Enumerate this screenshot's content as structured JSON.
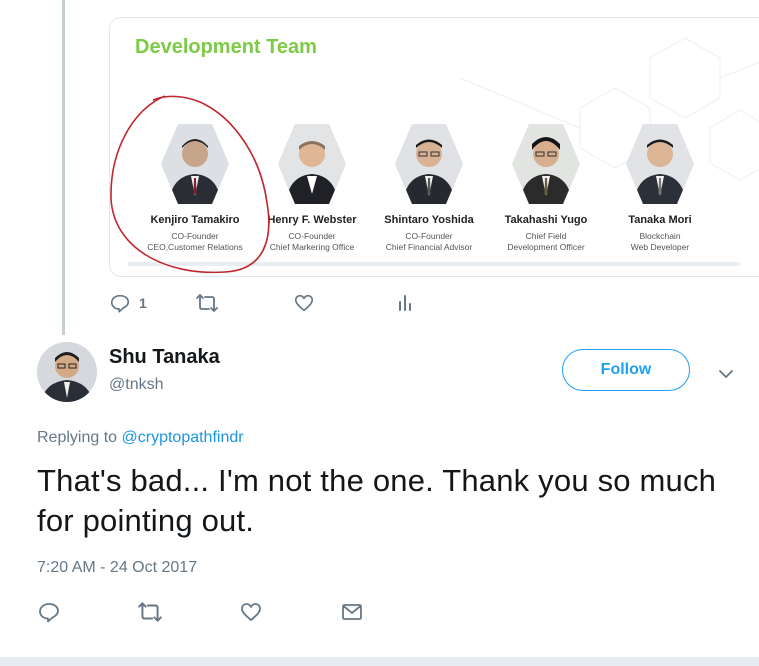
{
  "card": {
    "title": "Development Team",
    "members": [
      {
        "name": "Kenjiro Tamakiro",
        "role1": "CO-Founder",
        "role2": "CEO,Customer Relations"
      },
      {
        "name": "Henry F. Webster",
        "role1": "CO-Founder",
        "role2": "Chief Markering Office"
      },
      {
        "name": "Shintaro Yoshida",
        "role1": "CO-Founder",
        "role2": "Chief Financial Advisor"
      },
      {
        "name": "Takahashi Yugo",
        "role1": "Chief Field",
        "role2": "Development Officer"
      },
      {
        "name": "Tanaka Mori",
        "role1": "Blockchain",
        "role2": "Web Developer"
      }
    ]
  },
  "top_tweet": {
    "reply_count": "1"
  },
  "tweet": {
    "display_name": "Shu Tanaka",
    "handle": "@tnksh",
    "follow_label": "Follow",
    "replying_prefix": "Replying to",
    "replying_to": "@cryptopathfindr",
    "text": "That's bad... I'm not the one. Thank you so much for pointing out.",
    "timestamp": "7:20 AM - 24 Oct 2017"
  },
  "colors": {
    "accent": "#1da1f2",
    "title_green": "#7dcb45",
    "annotation_red": "#c0272d"
  },
  "icons": [
    "reply-icon",
    "retweet-icon",
    "like-icon",
    "analytics-icon",
    "chevron-down-icon",
    "message-icon"
  ]
}
